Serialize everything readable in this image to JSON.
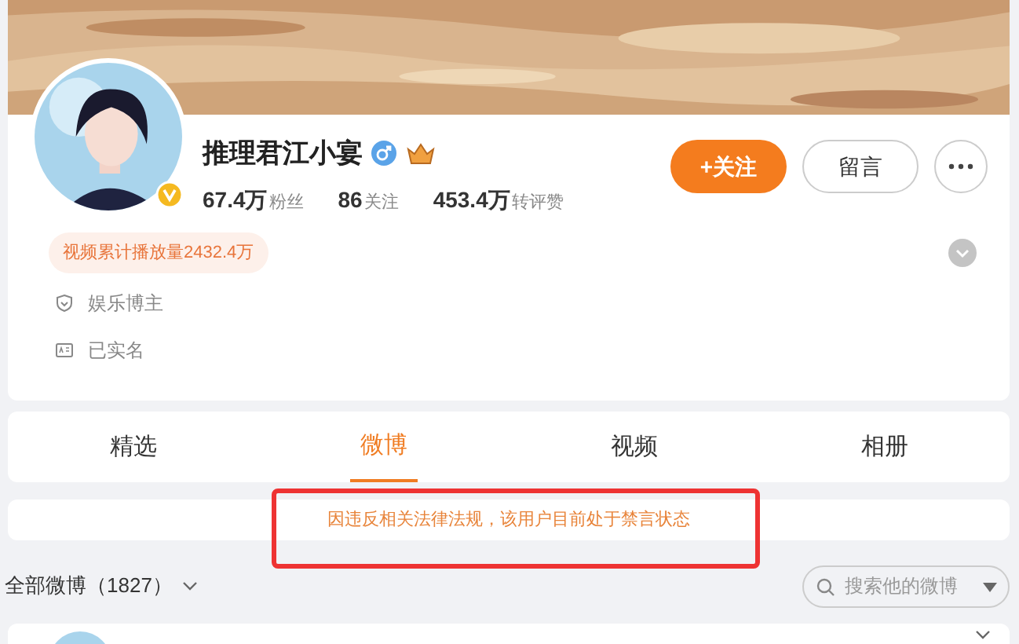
{
  "profile": {
    "name": "推理君江小宴",
    "verified": true,
    "male": true,
    "stats": [
      {
        "value": "67.4万",
        "label": "粉丝"
      },
      {
        "value": "86",
        "label": "关注"
      },
      {
        "value": "453.4万",
        "label": "转评赞"
      }
    ],
    "follow_button": "+关注",
    "message_button": "留言",
    "video_plays": "视频累计播放量2432.4万",
    "details": [
      {
        "kind": "role",
        "text": "娱乐博主"
      },
      {
        "kind": "realname",
        "text": "已实名"
      }
    ]
  },
  "tabs": [
    {
      "label": "精选",
      "selected": false
    },
    {
      "label": "微博",
      "selected": true
    },
    {
      "label": "视频",
      "selected": false
    },
    {
      "label": "相册",
      "selected": false
    }
  ],
  "notice": {
    "text": "因违反相关法律法规，该用户目前处于禁言状态",
    "highlighted": true
  },
  "feed": {
    "filter": "全部微博（1827）",
    "search": {
      "placeholder": "搜索他的微博"
    }
  }
}
